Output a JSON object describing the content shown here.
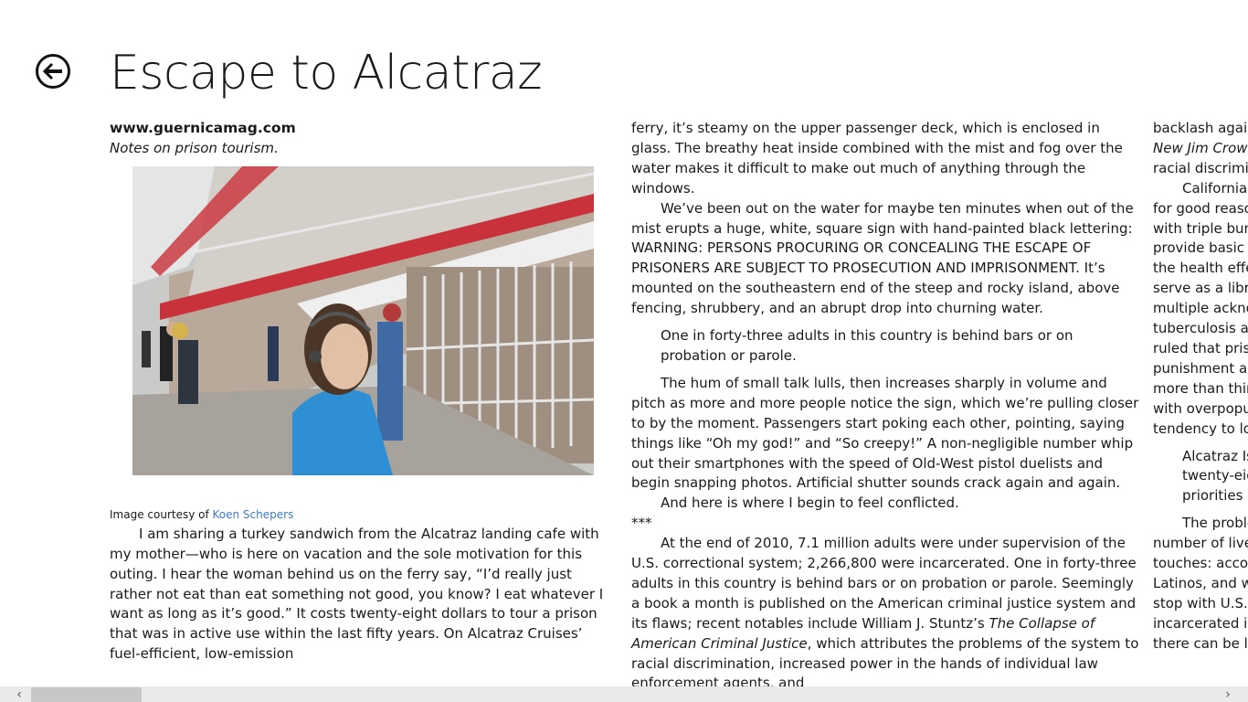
{
  "page": {
    "title": "Escape to Alcatraz"
  },
  "article": {
    "source": "www.guernicamag.com",
    "dek": "Notes on prison tourism.",
    "caption_prefix": "Image courtesy of ",
    "caption_link": "Koen Schepers",
    "col1": {
      "p1": "I am sharing a turkey sandwich from the Alcatraz landing cafe with my mother—who is here on vacation and the sole motivation for this outing. I hear the woman behind us on the ferry say, “I’d really just rather not eat than eat something not good, you know? I eat whatever I want as long as it’s good.” It costs twenty-eight dollars to tour a prison that was in active use within the last fifty years. On Alcatraz Cruises’ fuel-efficient, low-emission"
    },
    "col2": {
      "p1": "ferry, it’s steamy on the upper passenger deck, which is enclosed in glass. The breathy heat inside combined with the mist and fog over the water makes it difficult to make out much of anything through the windows.",
      "p2": "We’ve been out on the water for maybe ten minutes when out of the mist erupts a huge, white, square sign with hand-painted black lettering: WARNING: PERSONS PROCURING OR CONCEALING THE ESCAPE OF PRISONERS ARE SUBJECT TO PROSECUTION AND IMPRISONMENT. It’s mounted on the southeastern end of the steep and rocky island, above fencing, shrubbery, and an abrupt drop into churning water.",
      "quote": "One in forty-three adults in this country is behind bars or on probation or parole.",
      "p3": "The hum of small talk lulls, then increases sharply in volume and pitch as more and more people notice the sign, which we’re pulling closer to by the moment. Passengers start poking each other, pointing, saying things like “Oh my god!” and “So creepy!” A non-negligible number whip out their smartphones with the speed of Old-West pistol duelists and begin snapping photos. Artificial shutter sounds crack again and again.",
      "p4": "And here is where I begin to feel conflicted.",
      "stars": "***",
      "p5_a": "At the end of 2010, 7.1 million adults were under supervision of the U.S. correctional system; 2,266,800 were incarcerated. One in forty-three adults in this country is behind bars or on probation or parole. Seemingly a book a month is published on the American criminal justice system and its flaws; recent notables include William J. Stuntz’s ",
      "p5_em": "The Collapse of American Criminal Justice",
      "p5_b": ", which attributes the problems of the system to racial discrimination, increased power in the hands of individual law enforcement agents, and"
    },
    "col3": {
      "lines": [
        "backlash again",
        "New Jim Crow",
        "racial discrimin",
        "California’",
        "for good reaso",
        "with triple bun",
        "provide basic s",
        "the health effe",
        "serve as a libra",
        "multiple ackno",
        "tuberculosis an",
        "ruled that priso",
        "punishment an",
        "more than thir",
        "with overpopu",
        "tendency to lo",
        "Alcatraz Is",
        "twenty-eig",
        "priorities n",
        "The proble",
        "number of live",
        "touches: accor",
        "Latinos, and wh",
        "stop with U.S. c",
        "incarcerated in",
        "there can be lit"
      ]
    }
  },
  "scrollbar": {
    "left_arrow": "‹",
    "right_arrow": "›"
  }
}
